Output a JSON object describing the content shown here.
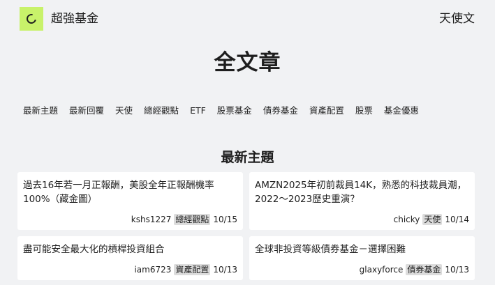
{
  "header": {
    "site_name": "超強基金",
    "right_link": "天使文"
  },
  "page_title": "全文章",
  "categories": [
    "最新主題",
    "最新回覆",
    "天使",
    "總經觀點",
    "ETF",
    "股票基金",
    "債券基金",
    "資產配置",
    "股票",
    "基金優惠"
  ],
  "section_title": "最新主題",
  "posts": [
    {
      "title": "過去16年若一月正報酬，美股全年正報酬機率100%（藏金圖）",
      "author": "kshs1227",
      "tag": "總經觀點",
      "date": "10/15"
    },
    {
      "title": "AMZN2025年初前裁員14K，熟悉的科技裁員潮，2022～2023歷史重演？",
      "author": "chicky",
      "tag": "天使",
      "date": "10/14"
    },
    {
      "title": "盡可能安全最大化的槓桿投資組合",
      "author": "iam6723",
      "tag": "資產配置",
      "date": "10/13"
    },
    {
      "title": "全球非投資等級債券基金－選擇困難",
      "author": "glaxyforce",
      "tag": "債券基金",
      "date": "10/13"
    }
  ]
}
